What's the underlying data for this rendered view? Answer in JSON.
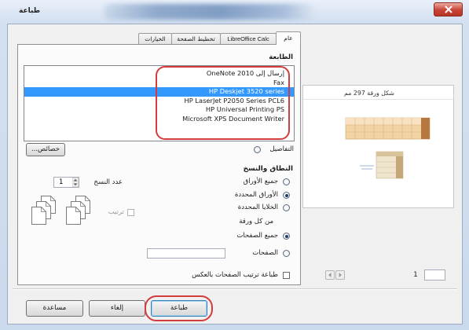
{
  "window": {
    "title": "طباعة"
  },
  "tabs": [
    {
      "label": "عام",
      "selected": true
    },
    {
      "label": "LibreOffice Calc",
      "selected": false
    },
    {
      "label": "تخطيط الصفحة",
      "selected": false
    },
    {
      "label": "الخيارات",
      "selected": false
    }
  ],
  "printer": {
    "label": "الطابعة",
    "items": [
      "إرسال إلى OneNote 2010",
      "Fax",
      "HP Deskjet 3520 series",
      "HP LaserJet P2050 Series PCL6",
      "HP Universal Printing PS",
      "Microsoft XPS Document Writer"
    ],
    "selected_index": 2,
    "properties_button": "خصائص...",
    "details_label": "التفاصيل"
  },
  "range": {
    "heading": "النطاق والنسخ",
    "sheet_options": [
      {
        "label": "جميع الأوراق",
        "checked": false
      },
      {
        "label": "الأوراق المحددة",
        "checked": true
      },
      {
        "label": "الخلايا المحددة",
        "checked": false
      }
    ],
    "from_label": "من كل ورقة",
    "page_options": [
      {
        "label": "جميع الصفحات",
        "checked": true
      },
      {
        "label": "الصفحات",
        "checked": false
      }
    ],
    "pages_value": "",
    "reverse_label": "طباعة ترتيب الصفحات بالعكس",
    "reverse_checked": false
  },
  "copies": {
    "label": "عدد النسخ",
    "value": "1",
    "collate_label": "ترتيب",
    "collate_checked": false
  },
  "preview": {
    "title": "شكل ورقة 297 مم",
    "page_label": "1",
    "page_input": ""
  },
  "buttons": {
    "help": "مساعدة",
    "cancel": "إلغاء",
    "print": "طباعة"
  },
  "colors": {
    "selection": "#3399ff",
    "annotation": "#d23c3c",
    "close_button": "#c74436",
    "preview_cell": "#f2d3a4",
    "preview_cell_dark": "#b6783f"
  },
  "icons": {
    "close": "close-icon",
    "details": "details-expander-icon",
    "collate": "collate-icon",
    "spinner": "spinner-arrows-icon",
    "prev_page": "chevron-left-icon",
    "next_page": "chevron-right-icon"
  }
}
